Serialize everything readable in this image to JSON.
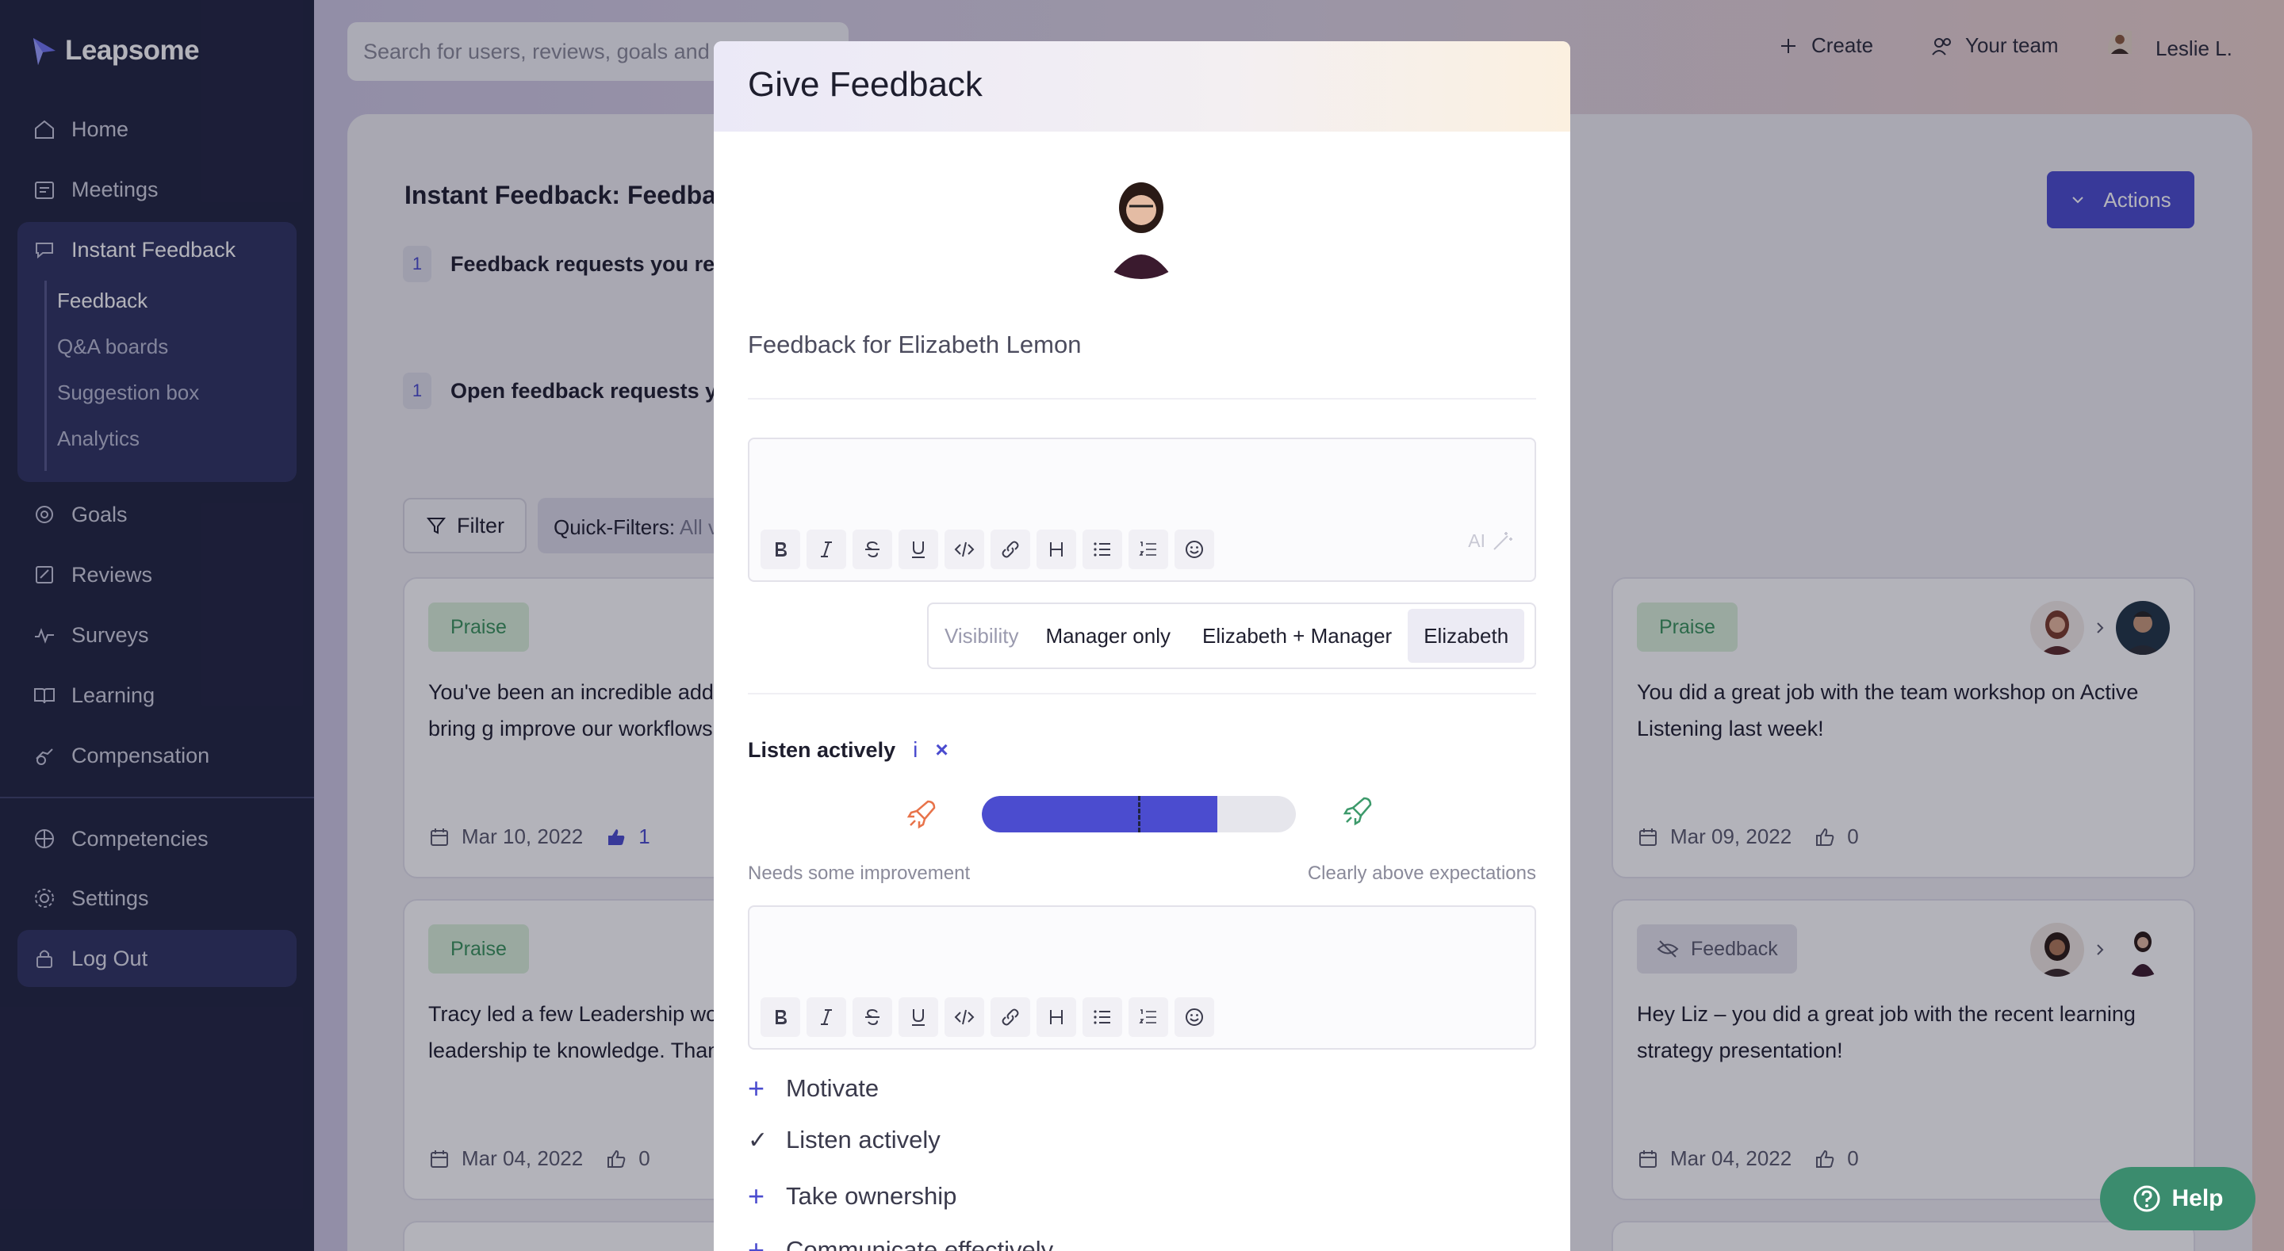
{
  "app": {
    "logo": "Leapsome"
  },
  "sidebar": {
    "items": [
      {
        "label": "Home",
        "icon": "home-icon"
      },
      {
        "label": "Meetings",
        "icon": "meetings-icon"
      },
      {
        "label": "Instant Feedback",
        "icon": "feedback-icon"
      },
      {
        "label": "Goals",
        "icon": "goals-icon"
      },
      {
        "label": "Reviews",
        "icon": "reviews-icon"
      },
      {
        "label": "Surveys",
        "icon": "surveys-icon"
      },
      {
        "label": "Learning",
        "icon": "learning-icon"
      },
      {
        "label": "Compensation",
        "icon": "compensation-icon"
      },
      {
        "label": "Competencies",
        "icon": "competencies-icon"
      },
      {
        "label": "Settings",
        "icon": "settings-icon"
      },
      {
        "label": "Log Out",
        "icon": "lock-icon"
      }
    ],
    "subitems": [
      "Feedback",
      "Q&A boards",
      "Suggestion box",
      "Analytics"
    ]
  },
  "topbar": {
    "search_text": "Search for users, reviews, goals and m",
    "create": "Create",
    "your_team": "Your team",
    "user": "Leslie L."
  },
  "page": {
    "title": "Instant Feedback: Feedback",
    "actions": "Actions",
    "requests": [
      {
        "count": "1",
        "label": "Feedback requests you rece"
      },
      {
        "count": "1",
        "label": "Open feedback requests yo"
      }
    ],
    "filter": "Filter",
    "quick_filters_label": "Quick-Filters:",
    "quick_filters_value": "All v"
  },
  "cards": [
    {
      "tag": "Praise",
      "text": "You've been an incredible addi engineering team - you bring g improve our workflows and ou",
      "date": "Mar 10, 2022",
      "likes": "1"
    },
    {
      "tag": "Praise",
      "text": "You did a great job with the team workshop on Active Listening last week!",
      "date": "Mar 09, 2022",
      "likes": "0"
    },
    {
      "tag": "Praise",
      "text": "Tracy led a few Leadership wo really helped our leadership te knowledge. Thanks!",
      "date": "Mar 04, 2022",
      "likes": "0"
    },
    {
      "tag": "Feedback",
      "text": "Hey Liz – you did a great job with the recent learning strategy presentation!",
      "date": "Mar 04, 2022",
      "likes": "0"
    }
  ],
  "modal": {
    "title": "Give Feedback",
    "feedback_for": "Feedback for Elizabeth Lemon",
    "ai_label": "AI",
    "visibility": {
      "label": "Visibility",
      "options": [
        "Manager only",
        "Elizabeth + Manager",
        "Elizabeth"
      ],
      "selected": "Elizabeth"
    },
    "competency": {
      "title": "Listen actively",
      "info": "i",
      "remove": "×",
      "rating_fraction": 0.75,
      "scale_low": "Needs some improvement",
      "scale_high": "Clearly above expectations"
    },
    "competency_list": [
      {
        "label": "Motivate",
        "state": "+"
      },
      {
        "label": "Listen actively",
        "state": "✓"
      },
      {
        "label": "Take ownership",
        "state": "+"
      },
      {
        "label": "Communicate effectively",
        "state": "+"
      }
    ]
  },
  "help": "Help",
  "colors": {
    "accent": "#4b4ccf",
    "sidebar": "#20243f",
    "praise": "#39935a",
    "help": "#3b8c6e"
  }
}
